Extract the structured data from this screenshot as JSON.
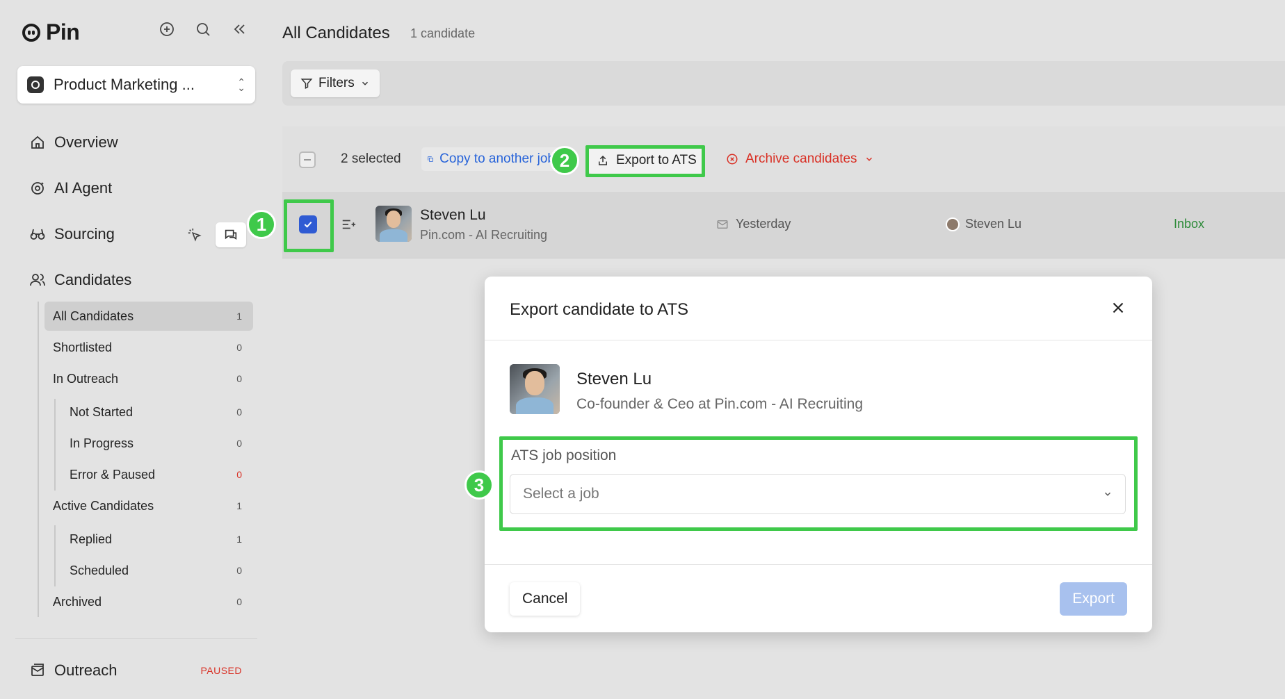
{
  "app": {
    "name": "Pin"
  },
  "sidebar": {
    "job_selector": "Product Marketing ...",
    "nav": {
      "overview": "Overview",
      "ai_agent": "AI Agent",
      "sourcing": "Sourcing",
      "candidates": "Candidates",
      "outreach": "Outreach",
      "outreach_status": "PAUSED"
    },
    "candidate_groups": [
      {
        "label": "All Candidates",
        "count": "1"
      },
      {
        "label": "Shortlisted",
        "count": "0"
      },
      {
        "label": "In Outreach",
        "count": "0"
      },
      {
        "label": "Not Started",
        "count": "0"
      },
      {
        "label": "In Progress",
        "count": "0"
      },
      {
        "label": "Error & Paused",
        "count": "0"
      },
      {
        "label": "Active Candidates",
        "count": "1"
      },
      {
        "label": "Replied",
        "count": "1"
      },
      {
        "label": "Scheduled",
        "count": "0"
      },
      {
        "label": "Archived",
        "count": "0"
      }
    ]
  },
  "main": {
    "title": "All Candidates",
    "count": "1 candidate",
    "filters_label": "Filters",
    "toolbar": {
      "selected": "2 selected",
      "copy": "Copy to another job",
      "export": "Export to ATS",
      "archive": "Archive candidates"
    },
    "row": {
      "name": "Steven Lu",
      "company": "Pin.com - AI Recruiting",
      "last_activity": "Yesterday",
      "owner": "Steven Lu",
      "stage": "Inbox"
    }
  },
  "modal": {
    "title": "Export candidate to ATS",
    "candidate_name": "Steven Lu",
    "candidate_role": "Co-founder & Ceo at Pin.com - AI Recruiting",
    "field_label": "ATS job position",
    "placeholder": "Select a job",
    "cancel": "Cancel",
    "export": "Export"
  },
  "annotations": {
    "step1": "1",
    "step2": "2",
    "step3": "3"
  },
  "colors": {
    "highlight": "#3fc94a",
    "link": "#2864d9",
    "danger": "#d93025",
    "primary_disabled": "#a8c1ee",
    "checkbox": "#2f5bd3"
  }
}
